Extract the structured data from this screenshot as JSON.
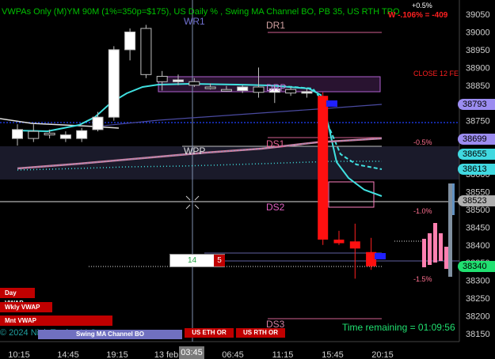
{
  "header": {
    "title": "VWPAs Only (M)YM 90M (1%=350p=$175), US Daily % , Swing MA Channel BO, PB 35, US RTH TPO",
    "top_right_pct": "+0.5%",
    "top_right_pnl": "W -.106% = -409"
  },
  "chart_data": {
    "type": "candlestick",
    "ylim": [
      38130,
      39060
    ],
    "x_tick_labels": [
      "10:15",
      "14:45",
      "19:15",
      "13 feb",
      "03:45",
      "06:45",
      "11:15",
      "15:45",
      "20:15"
    ],
    "y_tick_labels": [
      "39050",
      "39000",
      "38950",
      "38900",
      "38850",
      "38800",
      "38750",
      "38700",
      "38650",
      "38600",
      "38550",
      "38500",
      "38450",
      "38400",
      "38350",
      "38300",
      "38250",
      "38200",
      "38150"
    ],
    "candles": [
      {
        "o": 38700,
        "h": 38740,
        "l": 38680,
        "c": 38725
      },
      {
        "o": 38720,
        "h": 38740,
        "l": 38690,
        "c": 38700
      },
      {
        "o": 38715,
        "h": 38725,
        "l": 38700,
        "c": 38710
      },
      {
        "o": 38700,
        "h": 38720,
        "l": 38690,
        "c": 38710
      },
      {
        "o": 38700,
        "h": 38730,
        "l": 38690,
        "c": 38722
      },
      {
        "o": 38725,
        "h": 38775,
        "l": 38720,
        "c": 38760
      },
      {
        "o": 38760,
        "h": 38960,
        "l": 38750,
        "c": 38950
      },
      {
        "o": 38950,
        "h": 39010,
        "l": 38920,
        "c": 39000
      },
      {
        "o": 39010,
        "h": 39020,
        "l": 38870,
        "c": 38880
      },
      {
        "o": 38875,
        "h": 38890,
        "l": 38835,
        "c": 38860
      },
      {
        "o": 38860,
        "h": 38880,
        "l": 38850,
        "c": 38865
      },
      {
        "o": 38860,
        "h": 38870,
        "l": 38845,
        "c": 38850
      },
      {
        "o": 38845,
        "h": 38855,
        "l": 38838,
        "c": 38842
      },
      {
        "o": 38838,
        "h": 38848,
        "l": 38832,
        "c": 38835
      },
      {
        "o": 38835,
        "h": 38850,
        "l": 38828,
        "c": 38845
      },
      {
        "o": 38845,
        "h": 38900,
        "l": 38815,
        "c": 38830
      },
      {
        "o": 38830,
        "h": 38850,
        "l": 38800,
        "c": 38840
      },
      {
        "o": 38838,
        "h": 38845,
        "l": 38820,
        "c": 38828
      },
      {
        "o": 38828,
        "h": 38840,
        "l": 38815,
        "c": 38832
      },
      {
        "o": 38820,
        "h": 38830,
        "l": 38400,
        "c": 38415
      },
      {
        "o": 38415,
        "h": 38440,
        "l": 38400,
        "c": 38405
      },
      {
        "o": 38410,
        "h": 38460,
        "l": 38305,
        "c": 38390
      },
      {
        "o": 38380,
        "h": 38420,
        "l": 38330,
        "c": 38340
      }
    ],
    "level_labels": {
      "wr1": "WR1",
      "dr1": "DR1",
      "drp": "DRP",
      "wpp": "WPP",
      "ds1": "DS1",
      "ds2": "DS2",
      "ds3": "DS3"
    },
    "pct_labels": [
      "-0.5%",
      "-1.0%",
      "-1.5%"
    ],
    "close_label": "CLOSE 12 FE",
    "price_tags": [
      {
        "value": "38793",
        "color": "#9b8cf0"
      },
      {
        "value": "38699",
        "color": "#9b8cf0"
      },
      {
        "value": "38655",
        "color": "#40d8e0"
      },
      {
        "value": "38613",
        "color": "#40d8e0"
      },
      {
        "value": "38523",
        "color": "#b0b0b0"
      },
      {
        "value": "38340",
        "color": "#20e070"
      }
    ],
    "box_values": {
      "left": "14",
      "right": "5"
    },
    "time_remaining": "Time remaining = 01:09:56",
    "copyright": "© 2024 NinjaTrader, LLC"
  },
  "left_buttons": [
    "Day VWAP",
    "Wkly VWAP",
    "Mnt VWAP"
  ],
  "bottom_buttons": [
    "Swing MA Channel BO",
    "US ETH OR",
    "US RTH OR"
  ],
  "crosshair_label": "03:45"
}
